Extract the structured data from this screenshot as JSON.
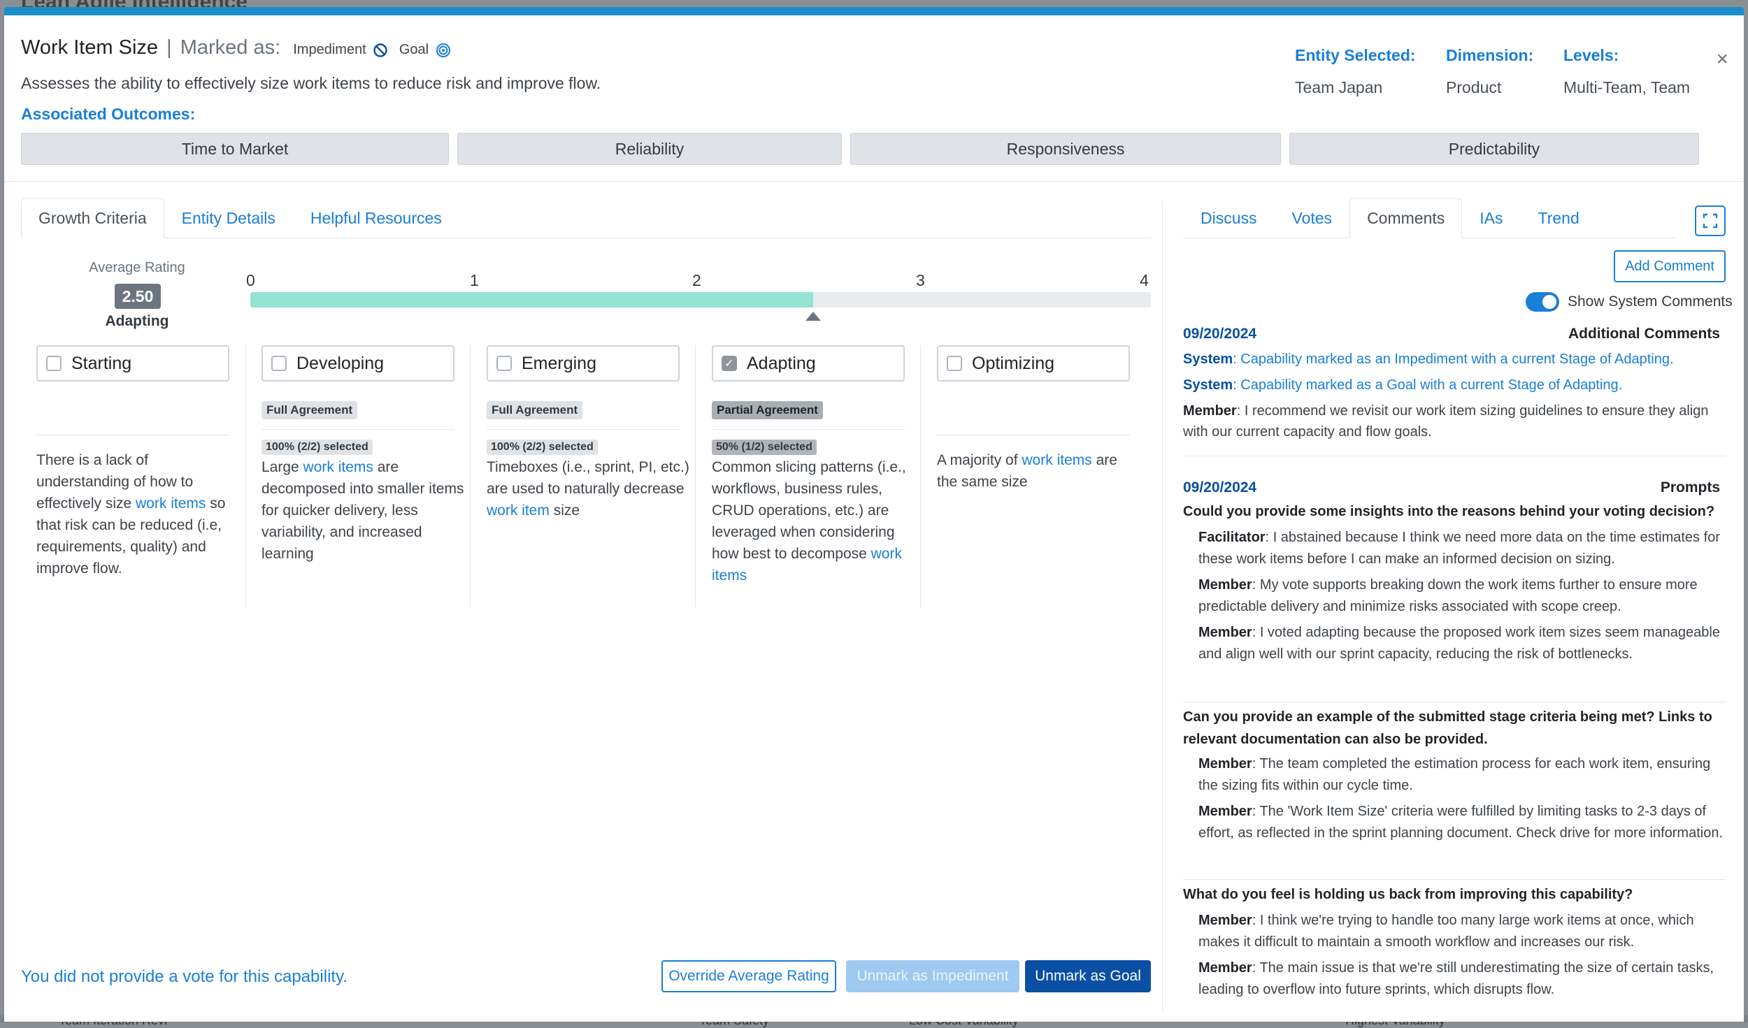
{
  "backdrop": {
    "app_title": "Lean Agile Intelligence",
    "bottom_labels": [
      "Team Iteration Revi",
      "Team Safety",
      "Low Cost Variability",
      "Highest Variability"
    ]
  },
  "modal": {
    "title": "Work Item Size",
    "marked_as_label": "Marked as:",
    "marks": [
      {
        "label": "Impediment",
        "icon": "no-entry-icon"
      },
      {
        "label": "Goal",
        "icon": "target-icon"
      }
    ],
    "description": "Assesses the ability to effectively size work items to reduce risk and improve flow.",
    "associated_outcomes_label": "Associated Outcomes:",
    "outcomes": [
      "Time to Market",
      "Reliability",
      "Responsiveness",
      "Predictability"
    ],
    "meta": {
      "entity_label": "Entity Selected:",
      "entity_value": "Team Japan",
      "dimension_label": "Dimension:",
      "dimension_value": "Product",
      "levels_label": "Levels:",
      "levels_value": "Multi-Team, Team"
    },
    "close": "×"
  },
  "left_tabs": [
    "Growth Criteria",
    "Entity Details",
    "Helpful Resources"
  ],
  "rating": {
    "label": "Average Rating",
    "value": "2.50",
    "stage": "Adapting",
    "scale": [
      "0",
      "1",
      "2",
      "3",
      "4"
    ],
    "fraction": 0.625
  },
  "stages": [
    {
      "name": "Starting",
      "checked": false,
      "agreement": "",
      "selected": "",
      "text_parts": [
        "There is a lack of understanding of how to effectively size ",
        "work items",
        " so that risk can be reduced (i.e, requirements, quality) and improve flow."
      ]
    },
    {
      "name": "Developing",
      "checked": false,
      "agreement": "Full Agreement",
      "selected": "100% (2/2) selected",
      "text_parts": [
        "Large ",
        "work items",
        " are decomposed into smaller items for quicker delivery, less variability, and increased learning"
      ]
    },
    {
      "name": "Emerging",
      "checked": false,
      "agreement": "Full Agreement",
      "selected": "100% (2/2) selected",
      "text_parts": [
        "Timeboxes (i.e., sprint, PI, etc.) are used to naturally decrease ",
        "work item",
        " size"
      ]
    },
    {
      "name": "Adapting",
      "checked": true,
      "agreement": "Partial Agreement",
      "selected": "50% (1/2) selected",
      "text_parts": [
        "Common slicing patterns (i.e., workflows, business rules, CRUD operations, etc.) are leveraged when considering how best to decompose ",
        "work items",
        ""
      ]
    },
    {
      "name": "Optimizing",
      "checked": false,
      "agreement": "",
      "selected": "",
      "text_parts": [
        "A majority of ",
        "work items",
        " are the same size"
      ]
    }
  ],
  "footer": {
    "vote_note": "You did not provide a vote for this capability.",
    "override_label": "Override Average Rating",
    "unmark_impediment_label": "Unmark as Impediment",
    "unmark_goal_label": "Unmark as Goal"
  },
  "right_tabs": [
    "Discuss",
    "Votes",
    "Comments",
    "IAs",
    "Trend"
  ],
  "comments_panel": {
    "add_comment_label": "Add Comment",
    "show_system_label": "Show System Comments",
    "show_system_on": true,
    "groups": [
      {
        "date": "09/20/2024",
        "type": "Additional Comments",
        "lines": [
          {
            "author": "System",
            "text": ": Capability marked as an Impediment with a current Stage of Adapting.",
            "system": true
          },
          {
            "author": "System",
            "text": ": Capability marked as a Goal with a current Stage of Adapting.",
            "system": true
          },
          {
            "author": "Member",
            "text": ": I recommend we revisit our work item sizing guidelines to ensure they align with our current capacity and flow goals.",
            "system": false
          }
        ]
      },
      {
        "date": "09/20/2024",
        "type": "Prompts",
        "questions": [
          {
            "q": "Could you provide some insights into the reasons behind your voting decision?",
            "answers": [
              {
                "author": "Facilitator",
                "text": ": I abstained because I think we need more data on the time estimates for these work items before I can make an informed decision on sizing."
              },
              {
                "author": "Member",
                "text": ": My vote supports breaking down the work items further to ensure more predictable delivery and minimize risks associated with scope creep."
              },
              {
                "author": "Member",
                "text": ": I voted adapting because the proposed work item sizes seem manageable and align well with our sprint capacity, reducing the risk of bottlenecks."
              }
            ]
          },
          {
            "q": "Can you provide an example of the submitted stage criteria being met? Links to relevant documentation can also be provided.",
            "answers": [
              {
                "author": "Member",
                "text": ": The team completed the estimation process for each work item, ensuring the sizing fits within our cycle time."
              },
              {
                "author": "Member",
                "text": ": The 'Work Item Size' criteria were fulfilled by limiting tasks to 2-3 days of effort, as reflected in the sprint planning document. Check drive for more information."
              }
            ]
          },
          {
            "q": "What do you feel is holding us back from improving this capability?",
            "answers": [
              {
                "author": "Member",
                "text": ": I think we're trying to handle too many large work items at once, which makes it difficult to maintain a smooth workflow and increases our risk."
              },
              {
                "author": "Member",
                "text": ": The main issue is that we're still underestimating the size of certain tasks, leading to overflow into future sprints, which disrupts flow."
              }
            ]
          }
        ]
      }
    ]
  },
  "colors": {
    "accent": "#1a7fd6",
    "primary_dark": "#0a4fa3",
    "progress_fill": "#93e4d4",
    "header_bar": "#1a8fc9"
  }
}
